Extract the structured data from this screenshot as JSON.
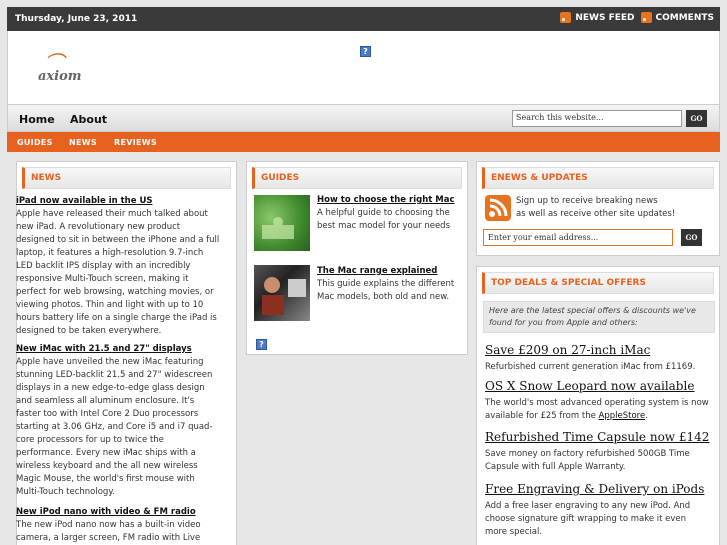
{
  "topbar": {
    "date": "Thursday, June 23, 2011",
    "news_feed": "NEWS FEED",
    "comments": "COMMENTS"
  },
  "logo": {
    "text": "axiom"
  },
  "nav": {
    "items": [
      "Home",
      "About"
    ],
    "search_placeholder": "Search this website...",
    "go": "GO"
  },
  "subnav": {
    "items": [
      "GUIDES",
      "NEWS",
      "REVIEWS"
    ]
  },
  "news": {
    "heading": "NEWS",
    "items": [
      {
        "title": "iPad now available in the US",
        "body": "Apple have released their much talked about new iPad. A revolutionary new product designed to sit in between the iPhone and a full laptop, it features a high-resolution 9.7-inch LED backlit IPS display with an incredibly responsive Multi-Touch screen, making it perfect for web browsing, watching movies, or viewing photos. Thin and light with up to 10 hours battery life on a single charge the iPad is designed to be taken everywhere."
      },
      {
        "title": "New iMac with 21.5 and 27\" displays",
        "body": "Apple have unveiled the new iMac featuring stunning LED-backlit 21.5 and 27\" widescreen displays in a new edge-to-edge glass design and seamless all aluminum enclosure. It's faster too with Intel Core 2 Duo processors starting at 3.06 GHz, and Core i5 and i7 quad-core processors for up to twice the performance. Every new iMac ships with a wireless keyboard and the all new wireless Magic Mouse, the world's first mouse with Multi-Touch technology."
      },
      {
        "title": "New iPod nano with video & FM radio",
        "body": "The new iPod nano now has a built-in video camera, a larger screen, FM radio with Live Pause,"
      }
    ]
  },
  "guides": {
    "heading": "GUIDES",
    "items": [
      {
        "title": "How to choose the right Mac",
        "body": "A helpful guide to choosing the best mac model for your needs"
      },
      {
        "title": "The Mac range explained",
        "body": "This guide explains the different Mac models, both old and new."
      }
    ]
  },
  "enews": {
    "heading": "ENEWS & UPDATES",
    "line1": "Sign up to receive breaking news",
    "line2": "as well as receive other site updates!",
    "email_placeholder": "Enter your email address...",
    "go": "GO"
  },
  "deals": {
    "heading": "TOP DEALS & SPECIAL OFFERS",
    "intro": "Here are the latest special offers & discounts we've found for you from Apple and others:",
    "items": [
      {
        "title": "Save £209 on 27-inch iMac",
        "body": "Refurbished current generation iMac from £1169."
      },
      {
        "title": "OS X Snow Leopard now available",
        "body": "The world's most advanced operating system is now available for £25 from the",
        "link": "AppleStore",
        "tail": "."
      },
      {
        "title": "Refurbished Time Capsule now £142",
        "body": "Save money on factory refurbished 500GB Time Capsule with full Apple Warranty."
      },
      {
        "title": "Free Engraving & Delivery on iPods",
        "body": "Add a free laser engraving to any new iPod. And choose signature gift wrapping to make it even more special."
      }
    ]
  }
}
